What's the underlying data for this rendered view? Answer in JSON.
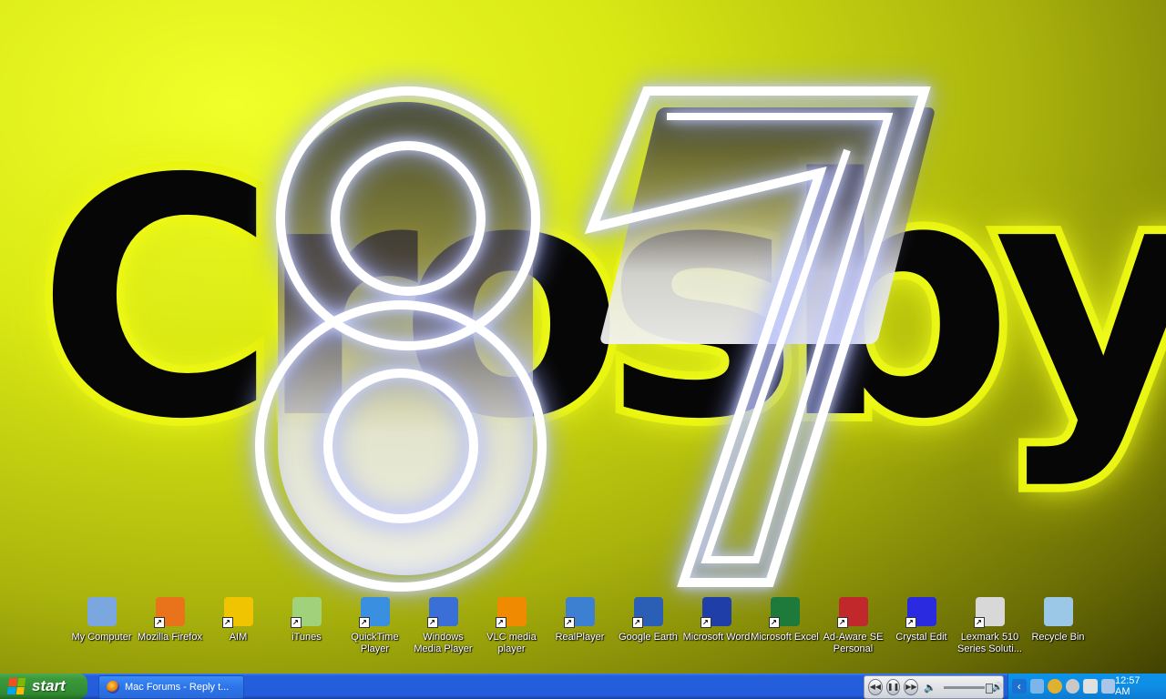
{
  "desktop": {
    "wallpaper_text": "Crosby",
    "wallpaper_number": "87",
    "icons": [
      {
        "label": "My Computer",
        "icon": "computer-icon",
        "color": "#7aa7e0",
        "shortcut": false
      },
      {
        "label": "Mozilla Firefox",
        "icon": "firefox-icon",
        "color": "#e8731a",
        "shortcut": true
      },
      {
        "label": "AIM",
        "icon": "aim-icon",
        "color": "#f0c400",
        "shortcut": true
      },
      {
        "label": "iTunes",
        "icon": "itunes-icon",
        "color": "#9fd27a",
        "shortcut": true
      },
      {
        "label": "QuickTime Player",
        "icon": "quicktime-icon",
        "color": "#3b8fe0",
        "shortcut": true
      },
      {
        "label": "Windows Media Player",
        "icon": "wmp-icon",
        "color": "#3a6fd8",
        "shortcut": true
      },
      {
        "label": "VLC media player",
        "icon": "vlc-icon",
        "color": "#f08a00",
        "shortcut": true
      },
      {
        "label": "RealPlayer",
        "icon": "realplayer-icon",
        "color": "#3d7fd0",
        "shortcut": true
      },
      {
        "label": "Google Earth",
        "icon": "google-earth-icon",
        "color": "#2b5fb6",
        "shortcut": true
      },
      {
        "label": "Microsoft Word",
        "icon": "word-icon",
        "color": "#1f3ea8",
        "shortcut": true
      },
      {
        "label": "Microsoft Excel",
        "icon": "excel-icon",
        "color": "#1d7a3a",
        "shortcut": true
      },
      {
        "label": "Ad-Aware SE Personal",
        "icon": "adaware-icon",
        "color": "#c0282b",
        "shortcut": true
      },
      {
        "label": "Crystal Edit",
        "icon": "crystal-edit-icon",
        "color": "#2a2ae0",
        "shortcut": true
      },
      {
        "label": "Lexmark 510 Series Soluti...",
        "icon": "printer-icon",
        "color": "#d8d8d8",
        "shortcut": true
      },
      {
        "label": "Recycle Bin",
        "icon": "recycle-bin-icon",
        "color": "#9cc8e8",
        "shortcut": false
      }
    ]
  },
  "taskbar": {
    "start_label": "start",
    "task_button_label": "Mac Forums - Reply t...",
    "clock": "12:57 AM",
    "colors": {
      "taskbar": "#245ddb",
      "start": "#3c9a3c",
      "tray": "#0f8ee5"
    }
  }
}
